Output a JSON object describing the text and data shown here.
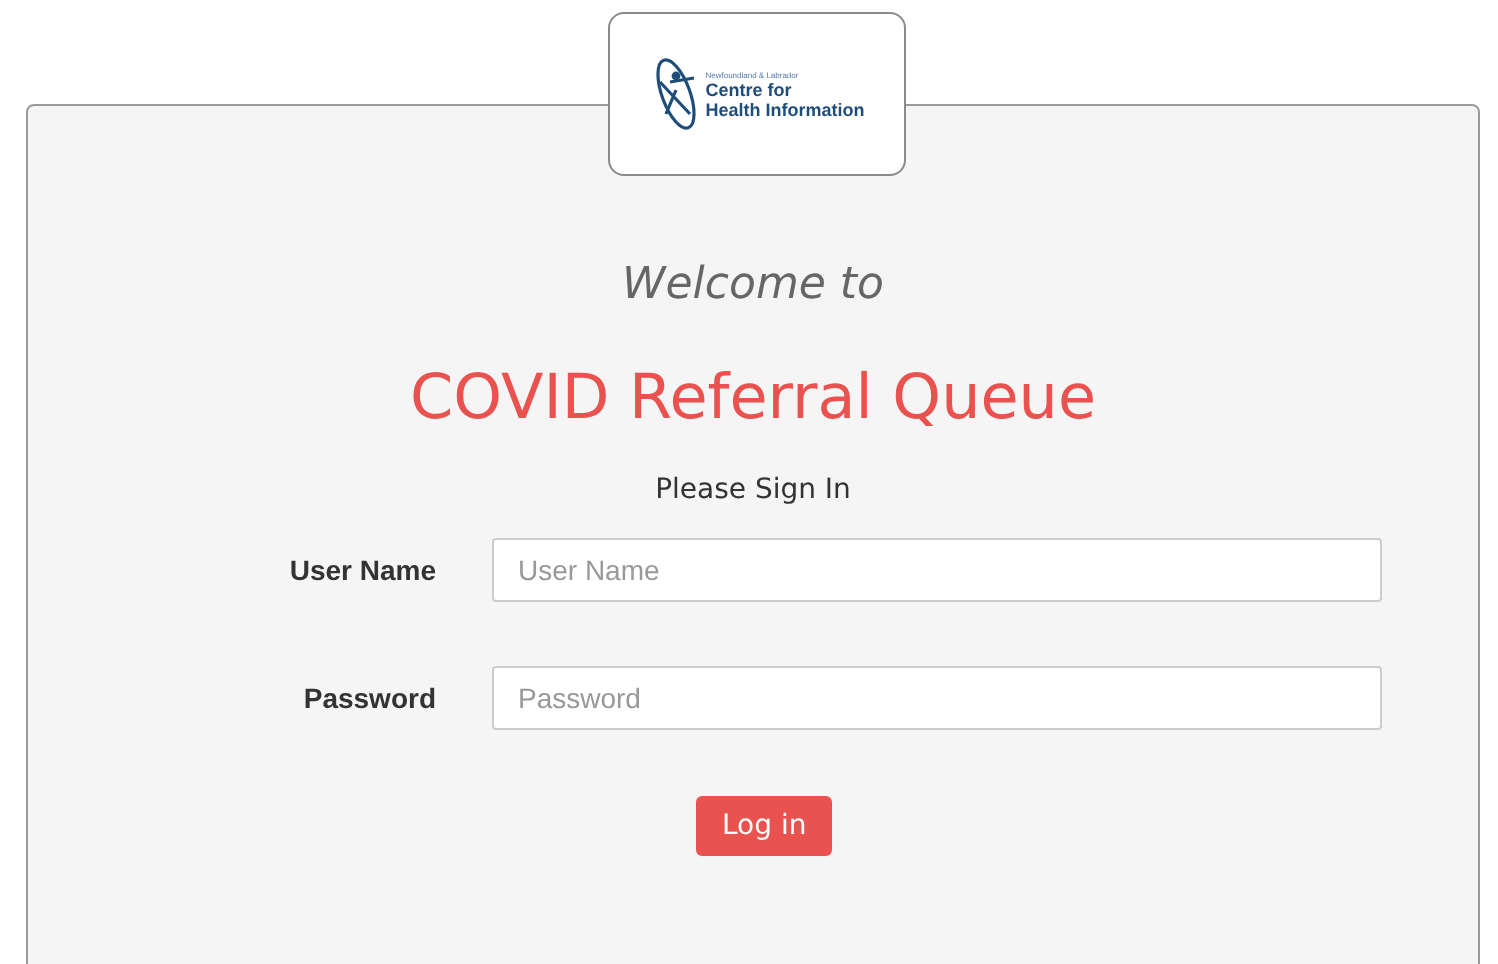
{
  "logo": {
    "subtitle": "Newfoundland & Labrador",
    "title_line_1": "Centre for",
    "title_line_2": "Health Information"
  },
  "welcome": "Welcome to",
  "title": "COVID Referral Queue",
  "prompt": "Please Sign In",
  "fields": [
    {
      "label": "User Name",
      "placeholder": "User Name"
    },
    {
      "label": "Password",
      "placeholder": "Password"
    }
  ],
  "button": "Log in"
}
